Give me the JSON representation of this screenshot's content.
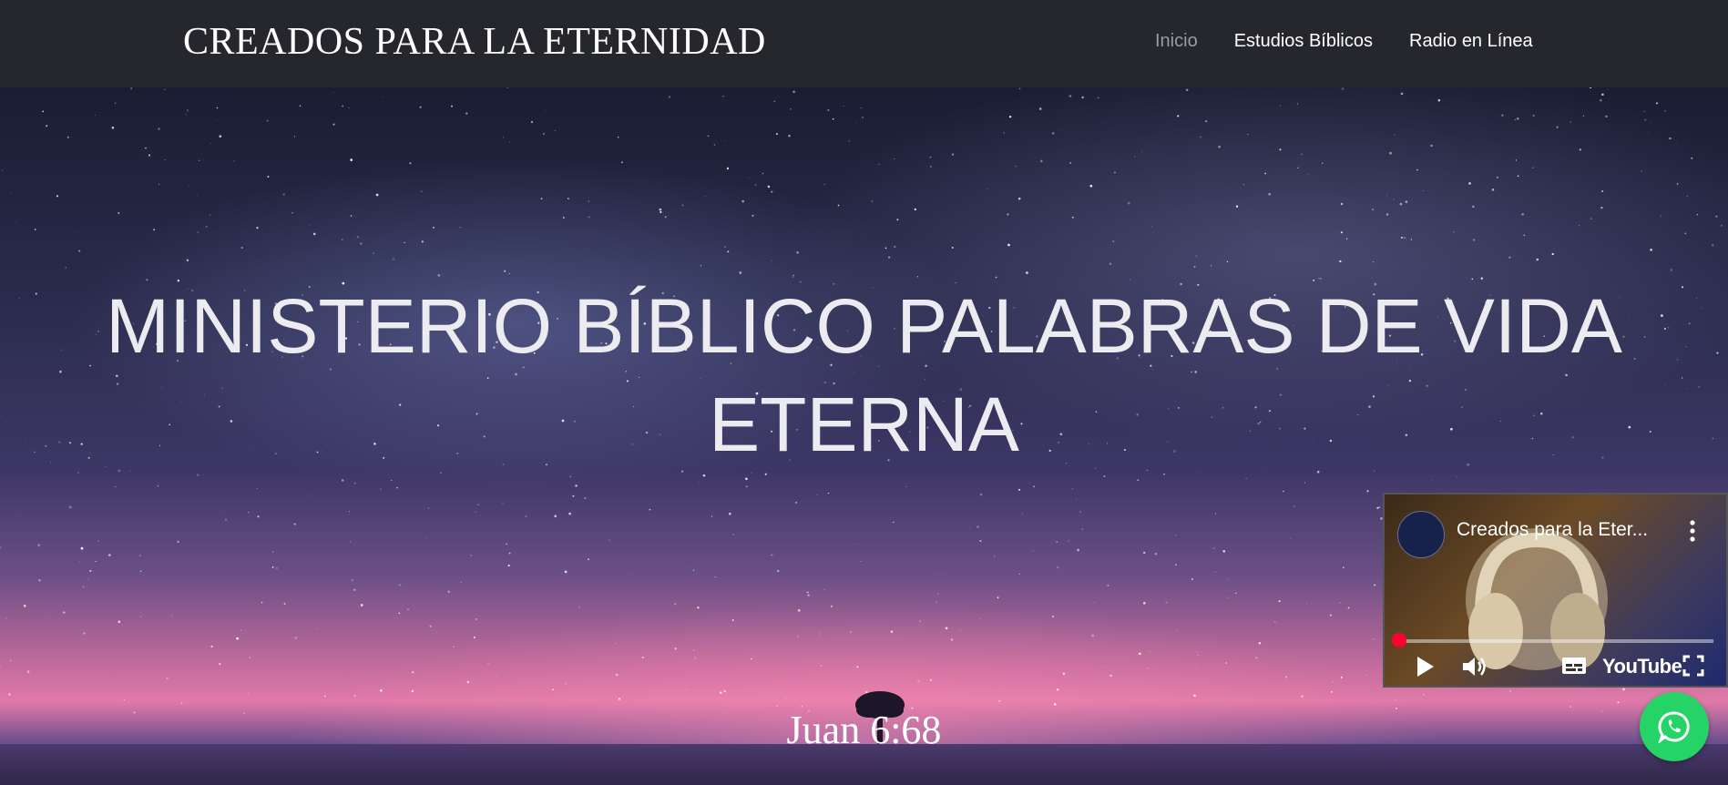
{
  "navbar": {
    "brand": "CREADOS PARA LA ETERNIDAD",
    "links": [
      {
        "label": "Inicio",
        "active": true
      },
      {
        "label": "Estudios Bíblicos",
        "active": false
      },
      {
        "label": "Radio en Línea",
        "active": false
      }
    ]
  },
  "hero": {
    "title": "MINISTERIO BÍBLICO PALABRAS DE VIDA ETERNA",
    "verse": "Juan 6:68"
  },
  "video": {
    "title": "Creados para la Eter...",
    "platform": "YouTube",
    "icons": [
      "channel-avatar",
      "more-vert-icon",
      "play-icon",
      "volume-icon",
      "subtitles-icon",
      "fullscreen-icon"
    ]
  },
  "whatsapp": {
    "icon": "whatsapp-icon",
    "color": "#25d366"
  },
  "colors": {
    "navbar_bg": "#26272c",
    "nav_active": "#9a9ba0",
    "nav_text": "#ffffff",
    "progress": "#ff0033"
  }
}
